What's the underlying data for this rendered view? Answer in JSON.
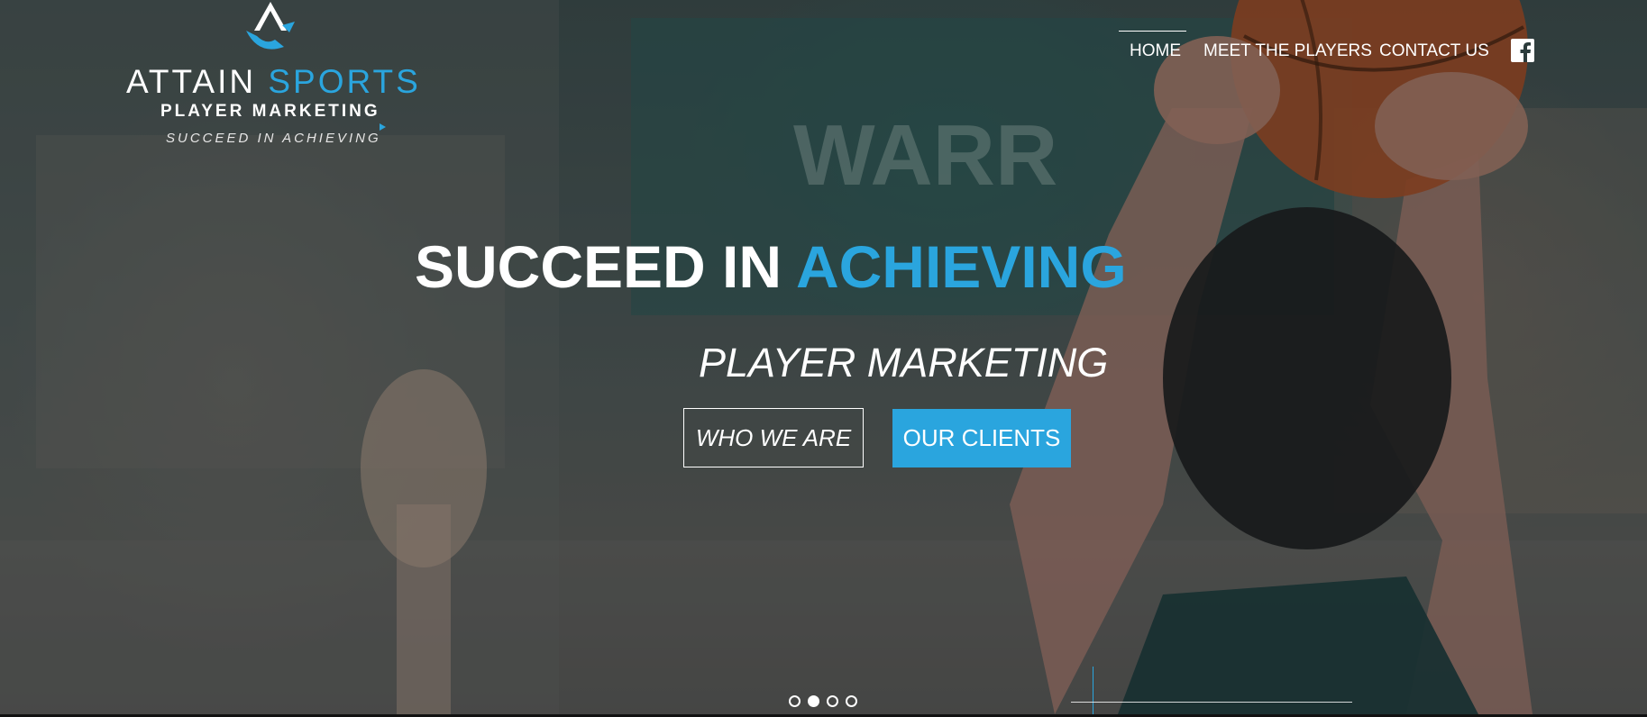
{
  "logo": {
    "brand_main": "ATTAIN",
    "brand_accent": "SPORTS",
    "subtitle": "PLAYER MARKETING",
    "tagline": "SUCCEED IN ACHIEVING"
  },
  "nav": {
    "items": [
      {
        "label": "HOME",
        "active": true
      },
      {
        "label": "MEET THE PLAYERS",
        "active": false
      },
      {
        "label": "CONTACT US",
        "active": false
      }
    ],
    "social_icon": "facebook-icon"
  },
  "hero": {
    "headline_main": "SUCCEED IN",
    "headline_accent": "ACHIEVING",
    "subheadline": "PLAYER MARKETING",
    "button_primary": "WHO WE ARE",
    "button_secondary": "OUR CLIENTS"
  },
  "slider": {
    "slide_count": 4,
    "active_index": 1
  },
  "colors": {
    "accent": "#2aa5de",
    "text": "#ffffff"
  }
}
